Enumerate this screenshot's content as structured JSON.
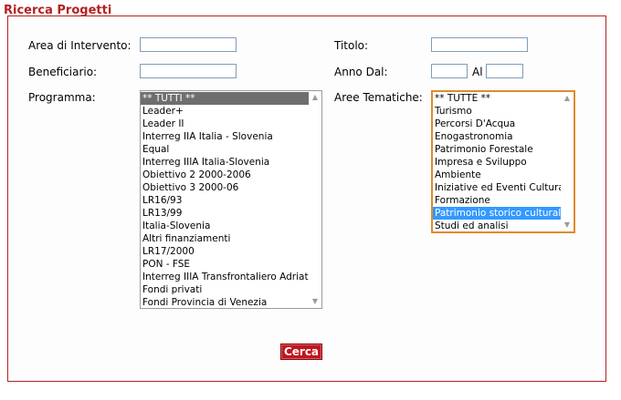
{
  "title": "Ricerca Progetti",
  "labels": {
    "area": "Area di Intervento:",
    "titolo": "Titolo:",
    "beneficiario": "Beneficiario:",
    "anno_dal": "Anno Dal:",
    "al": "Al",
    "programma": "Programma:",
    "aree_tematiche": "Aree Tematiche:"
  },
  "fields": {
    "area": "",
    "titolo": "",
    "beneficiario": "",
    "anno_dal": "",
    "anno_al": ""
  },
  "programma_options": [
    "** TUTTI **",
    "Leader+",
    "Leader II",
    "Interreg IIA Italia - Slovenia",
    "Equal",
    "Interreg IIIA Italia-Slovenia",
    "Obiettivo 2 2000-2006",
    "Obiettivo 3 2000-06",
    "LR16/93",
    "LR13/99",
    "Italia-Slovenia",
    "Altri finanziamenti",
    "LR17/2000",
    "PON - FSE",
    "Interreg IIIA Transfrontaliero Adriatico",
    "Fondi privati",
    "Fondi Provincia di Venezia"
  ],
  "aree_options": [
    "** TUTTE **",
    "Turismo",
    "Percorsi D'Acqua",
    "Enogastronomia",
    "Patrimonio Forestale",
    "Impresa e Sviluppo",
    "Ambiente",
    "Iniziative ed Eventi Culturali",
    "Formazione",
    "Patrimonio storico culturale",
    "Studi ed analisi"
  ],
  "programma_selected": "** TUTTI **",
  "aree_selected": "Patrimonio storico culturale",
  "search_button": "Cerca",
  "icons": {
    "scroll_up": "chevron-up-icon",
    "scroll_down": "chevron-down-icon"
  },
  "colors": {
    "accent": "#b22222",
    "button": "#c0161e",
    "focus": "#e08a2e",
    "selection": "#3399ff"
  }
}
